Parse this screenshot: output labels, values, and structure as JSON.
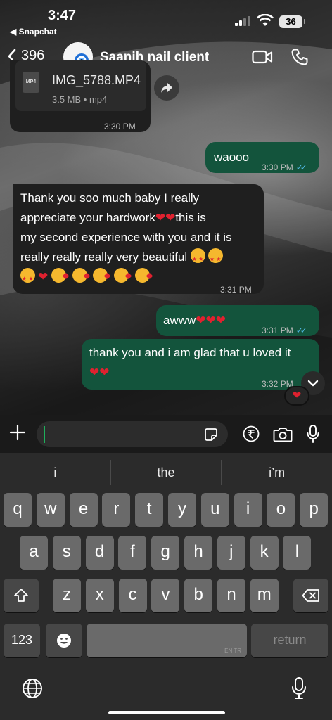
{
  "status_bar": {
    "time": "3:47",
    "back_app": "◀ Snapchat",
    "battery": "36"
  },
  "header": {
    "back_count": "396",
    "contact_name": "Saanjh nail client"
  },
  "messages": {
    "file": {
      "icon_label": "MP4",
      "name": "IMG_5788.MP4",
      "info": "3.5 MB • mp4",
      "time": "3:30 PM"
    },
    "m1": {
      "text": "waooo",
      "time": "3:30 PM"
    },
    "m2": {
      "line1": "Thank you soo much baby I really",
      "line2a": "appreciate your hardwork",
      "line2b": "this is",
      "line3": "my second experience with you and it is",
      "line4": "really really really very beautiful",
      "time": "3:31 PM"
    },
    "m3": {
      "text": "awww",
      "time": "3:31 PM"
    },
    "m4": {
      "text": "thank you and i am glad that u loved it",
      "time": "3:32 PM"
    },
    "heart": "❤",
    "reaction": "❤"
  },
  "colors": {
    "outgoing_bubble": "#13543c",
    "incoming_bubble": "#1f1f1f",
    "read_ticks": "#53bdeb",
    "heart": "#e0212f"
  },
  "keyboard": {
    "suggestions": [
      "i",
      "the",
      "i’m"
    ],
    "row1": [
      "q",
      "w",
      "e",
      "r",
      "t",
      "y",
      "u",
      "i",
      "o",
      "p"
    ],
    "row2": [
      "a",
      "s",
      "d",
      "f",
      "g",
      "h",
      "j",
      "k",
      "l"
    ],
    "row3": [
      "z",
      "x",
      "c",
      "v",
      "b",
      "n",
      "m"
    ],
    "numbers_label": "123",
    "space_hint": "EN TR",
    "return_label": "return"
  }
}
